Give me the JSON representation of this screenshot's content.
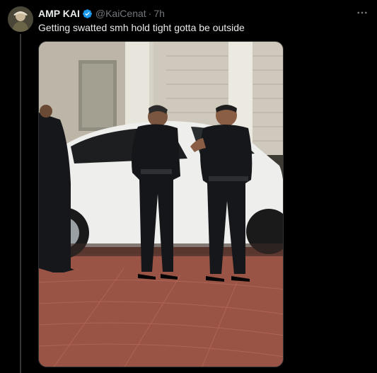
{
  "tweet": {
    "display_name": "AMP KAI",
    "handle": "@KaiCenat",
    "separator": "·",
    "time": "7h",
    "text": "Getting swatted smh hold tight gotta be outside",
    "more_icon": "more-horizontal-icon",
    "verified_icon": "verified-badge-icon",
    "media": {
      "type": "photo"
    }
  },
  "colors": {
    "background": "#000000",
    "text_primary": "#e7e9ea",
    "text_secondary": "#71767b",
    "verified_blue": "#1d9bf0",
    "divider": "#333639"
  }
}
